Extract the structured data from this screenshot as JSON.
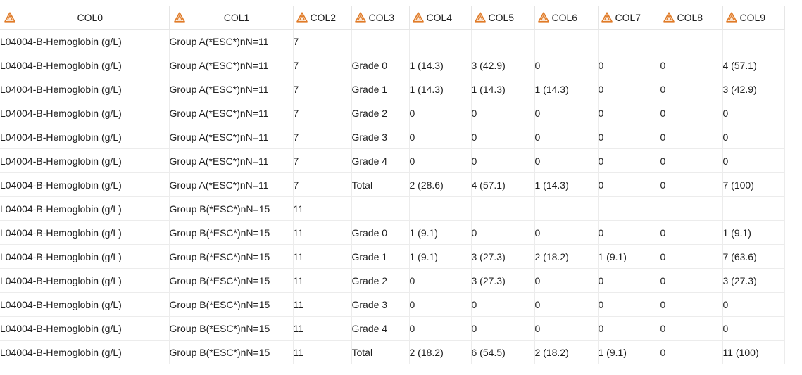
{
  "columns": [
    "COL0",
    "COL1",
    "COL2",
    "COL3",
    "COL4",
    "COL5",
    "COL6",
    "COL7",
    "COL8",
    "COL9"
  ],
  "header_icon": "warning-triangle-icon",
  "accent_color": "#e07b28",
  "rows": [
    [
      "L04004-B-Hemoglobin (g/L)",
      "Group A(*ESC*)nN=11",
      "7",
      "",
      "",
      "",
      "",
      "",
      "",
      ""
    ],
    [
      "L04004-B-Hemoglobin (g/L)",
      "Group A(*ESC*)nN=11",
      "7",
      "Grade 0",
      "1 (14.3)",
      "3 (42.9)",
      "0",
      "0",
      "0",
      "4 (57.1)"
    ],
    [
      "L04004-B-Hemoglobin (g/L)",
      "Group A(*ESC*)nN=11",
      "7",
      "Grade 1",
      "1 (14.3)",
      "1 (14.3)",
      "1 (14.3)",
      "0",
      "0",
      "3 (42.9)"
    ],
    [
      "L04004-B-Hemoglobin (g/L)",
      "Group A(*ESC*)nN=11",
      "7",
      "Grade 2",
      "0",
      "0",
      "0",
      "0",
      "0",
      "0"
    ],
    [
      "L04004-B-Hemoglobin (g/L)",
      "Group A(*ESC*)nN=11",
      "7",
      "Grade 3",
      "0",
      "0",
      "0",
      "0",
      "0",
      "0"
    ],
    [
      "L04004-B-Hemoglobin (g/L)",
      "Group A(*ESC*)nN=11",
      "7",
      "Grade 4",
      "0",
      "0",
      "0",
      "0",
      "0",
      "0"
    ],
    [
      "L04004-B-Hemoglobin (g/L)",
      "Group A(*ESC*)nN=11",
      "7",
      "Total",
      "2 (28.6)",
      "4 (57.1)",
      "1 (14.3)",
      "0",
      "0",
      "7  (100)"
    ],
    [
      "L04004-B-Hemoglobin (g/L)",
      "Group B(*ESC*)nN=15",
      "11",
      "",
      "",
      "",
      "",
      "",
      "",
      ""
    ],
    [
      "L04004-B-Hemoglobin (g/L)",
      "Group B(*ESC*)nN=15",
      "11",
      "Grade 0",
      "1  (9.1)",
      "0",
      "0",
      "0",
      "0",
      "1  (9.1)"
    ],
    [
      "L04004-B-Hemoglobin (g/L)",
      "Group B(*ESC*)nN=15",
      "11",
      "Grade 1",
      "1  (9.1)",
      "3 (27.3)",
      "2 (18.2)",
      "1  (9.1)",
      "0",
      "7 (63.6)"
    ],
    [
      "L04004-B-Hemoglobin (g/L)",
      "Group B(*ESC*)nN=15",
      "11",
      "Grade 2",
      "0",
      "3 (27.3)",
      "0",
      "0",
      "0",
      "3 (27.3)"
    ],
    [
      "L04004-B-Hemoglobin (g/L)",
      "Group B(*ESC*)nN=15",
      "11",
      "Grade 3",
      "0",
      "0",
      "0",
      "0",
      "0",
      "0"
    ],
    [
      "L04004-B-Hemoglobin (g/L)",
      "Group B(*ESC*)nN=15",
      "11",
      "Grade 4",
      "0",
      "0",
      "0",
      "0",
      "0",
      "0"
    ],
    [
      "L04004-B-Hemoglobin (g/L)",
      "Group B(*ESC*)nN=15",
      "11",
      "Total",
      "2 (18.2)",
      "6 (54.5)",
      "2 (18.2)",
      "1  (9.1)",
      "0",
      "11  (100)"
    ]
  ]
}
